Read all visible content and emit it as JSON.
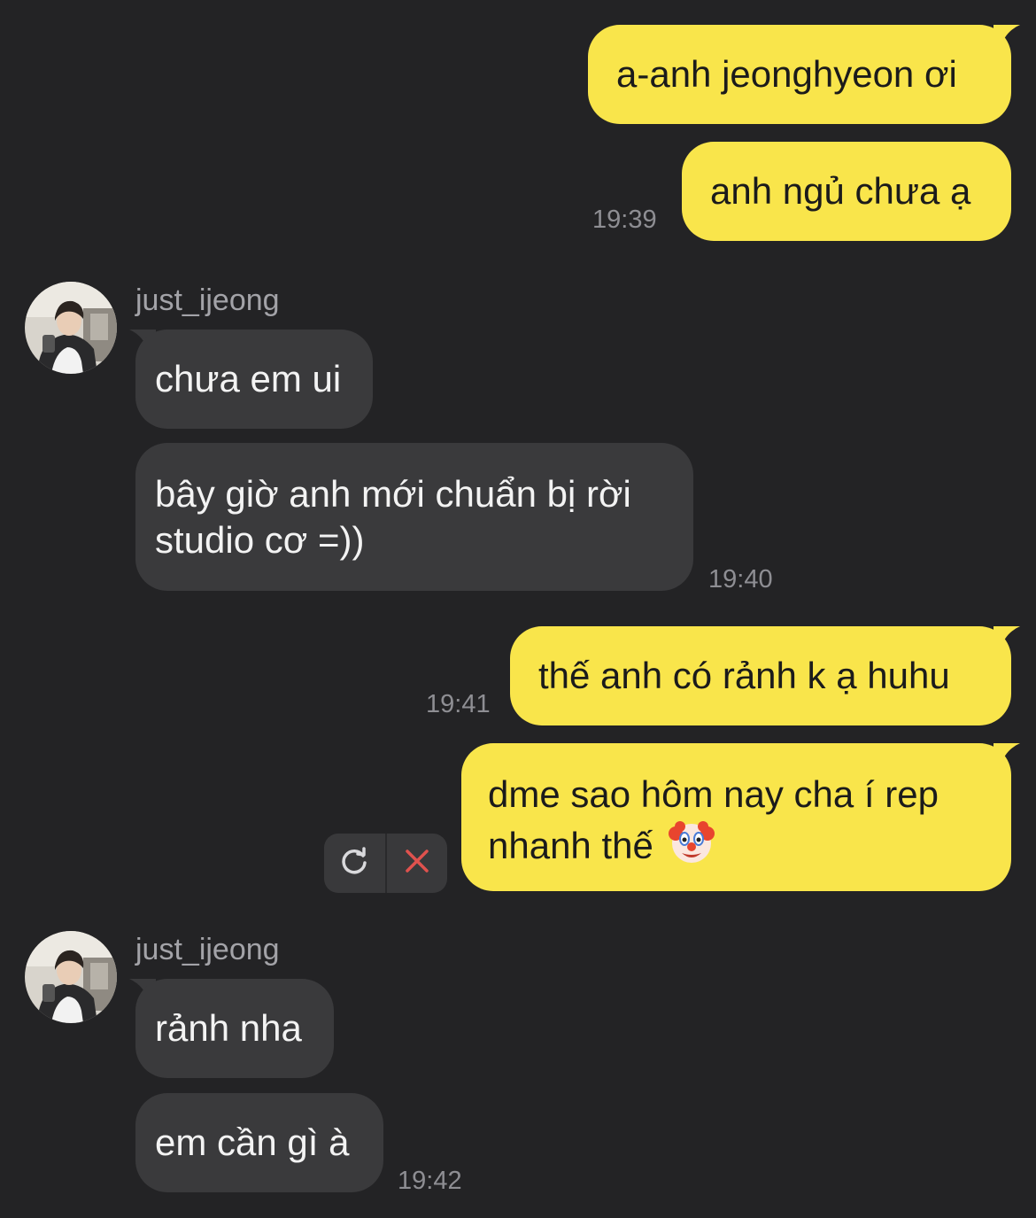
{
  "messages": {
    "m1": "a-anh jeonghyeon ơi",
    "m2": "anh ngủ chưa ạ",
    "m2_time": "19:39",
    "m3_sender": "just_ijeong",
    "m3": "chưa em ui",
    "m4_line1": "bây giờ anh mới chuẩn bị rời",
    "m4_line2": "studio cơ =))",
    "m4_time": "19:40",
    "m5": "thế anh có rảnh k ạ huhu",
    "m5_time": "19:41",
    "m6_line1": "dme sao hôm nay cha í rep",
    "m6_line2": "nhanh thế",
    "m6_emoji": "clown-face-emoji",
    "m7_sender": "just_ijeong",
    "m7": "rảnh nha",
    "m8": "em cần gì à",
    "m8_time": "19:42"
  },
  "failed_actions": {
    "retry_icon": "refresh-icon",
    "delete_icon": "close-icon"
  },
  "colors": {
    "background": "#232325",
    "outgoing_bubble": "#f9e54b",
    "incoming_bubble": "#3a3a3c",
    "timestamp": "#8e8e93",
    "delete_red": "#e0524e"
  }
}
